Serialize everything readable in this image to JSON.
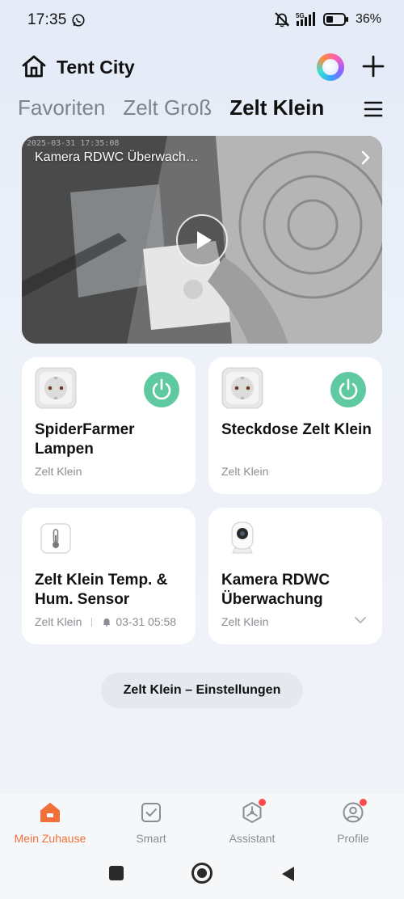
{
  "status_bar": {
    "time": "17:35",
    "battery_percent": "36%",
    "network": "5G",
    "icons": [
      "whatsapp-icon",
      "mute-icon",
      "signal-icon",
      "battery-icon"
    ]
  },
  "header": {
    "home_name": "Tent City",
    "icons": [
      "home-icon",
      "ai-orb-icon",
      "plus-icon"
    ]
  },
  "tabs": {
    "items": [
      {
        "label": "Favoriten",
        "active": false
      },
      {
        "label": "Zelt Groß",
        "active": false
      },
      {
        "label": "Zelt Klein",
        "active": true
      }
    ]
  },
  "camera": {
    "title": "Kamera RDWC Überwach…",
    "timestamp": "2025-03-31 17:35:08"
  },
  "devices": [
    {
      "name": "SpiderFarmer Lampen",
      "room": "Zelt Klein",
      "icon": "socket-icon",
      "power": true,
      "power_color": "#5fc9a1"
    },
    {
      "name": "Steckdose Zelt Klein",
      "room": "Zelt Klein",
      "icon": "socket-icon",
      "power": true,
      "power_color": "#5fc9a1"
    },
    {
      "name": "Zelt Klein Temp. & Hum. Sensor",
      "room": "Zelt Klein",
      "alert_time": "03-31 05:58",
      "icon": "thermometer-icon"
    },
    {
      "name": "Kamera RDWC Überwachung",
      "room": "Zelt Klein",
      "icon": "camera-icon"
    }
  ],
  "settings_button": {
    "label": "Zelt Klein – Einstellungen"
  },
  "bottom_nav": {
    "items": [
      {
        "label": "Mein Zuhause",
        "icon": "home-nav-icon",
        "active": true
      },
      {
        "label": "Smart",
        "icon": "smart-icon",
        "active": false
      },
      {
        "label": "Assistant",
        "icon": "assistant-icon",
        "active": false,
        "badge": true
      },
      {
        "label": "Profile",
        "icon": "profile-icon",
        "active": false,
        "badge": true
      }
    ]
  },
  "colors": {
    "accent": "#f0703a",
    "power_on": "#5fc9a1",
    "badge": "#ff4b4b"
  }
}
